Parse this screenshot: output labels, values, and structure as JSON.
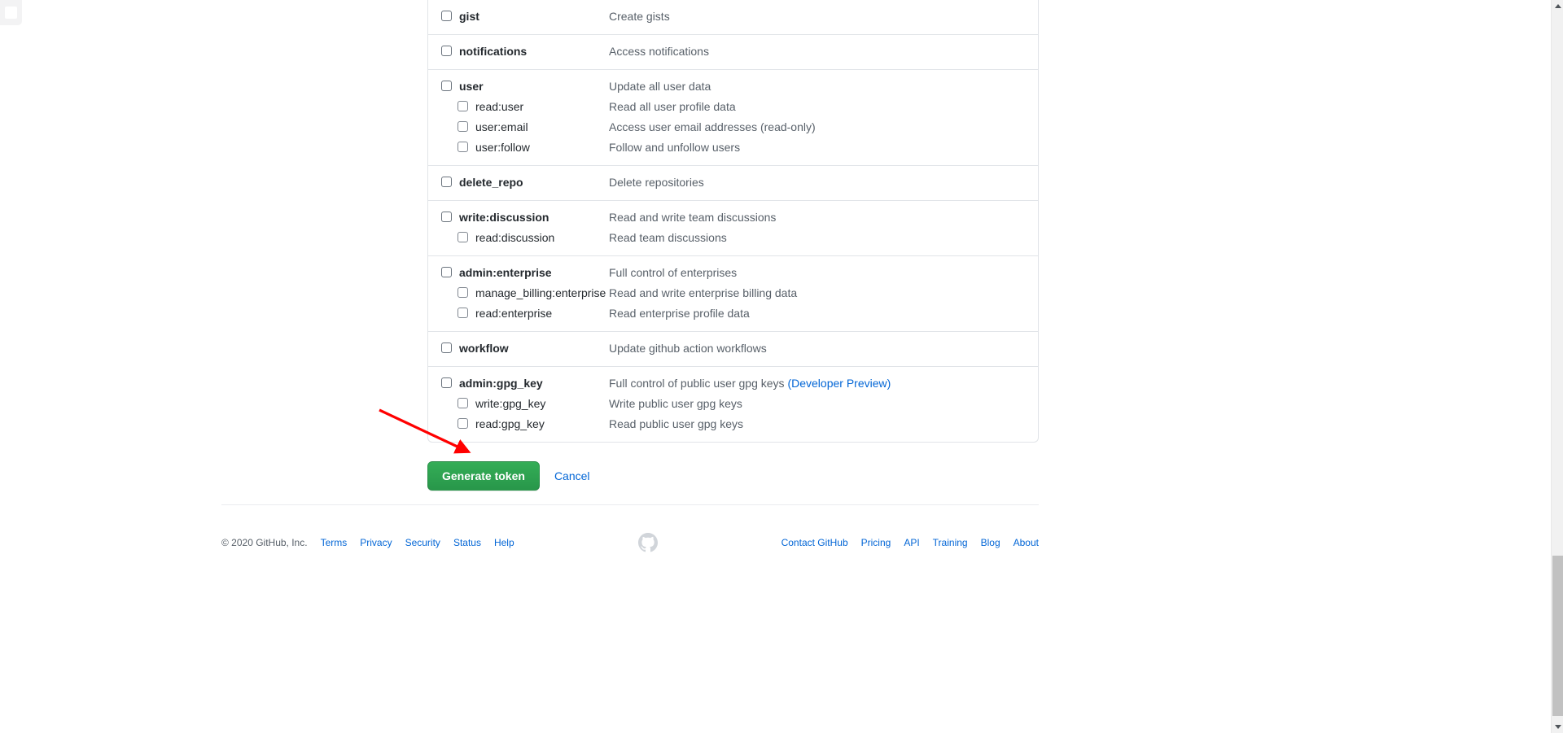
{
  "colors": {
    "primary_button": "#2ea44f",
    "link": "#0366d6",
    "text": "#24292e",
    "muted_text": "#586069",
    "border": "#e1e4e8",
    "annotation_arrow": "#ff0000"
  },
  "scopes": {
    "groups": [
      {
        "rows": [
          {
            "name": "gist",
            "description": "Create gists",
            "level": "parent",
            "checked": false
          }
        ]
      },
      {
        "rows": [
          {
            "name": "notifications",
            "description": "Access notifications",
            "level": "parent",
            "checked": false
          }
        ]
      },
      {
        "rows": [
          {
            "name": "user",
            "description": "Update all user data",
            "level": "parent",
            "checked": false
          },
          {
            "name": "read:user",
            "description": "Read all user profile data",
            "level": "child",
            "checked": false
          },
          {
            "name": "user:email",
            "description": "Access user email addresses (read-only)",
            "level": "child",
            "checked": false
          },
          {
            "name": "user:follow",
            "description": "Follow and unfollow users",
            "level": "child",
            "checked": false
          }
        ]
      },
      {
        "rows": [
          {
            "name": "delete_repo",
            "description": "Delete repositories",
            "level": "parent",
            "checked": false
          }
        ]
      },
      {
        "rows": [
          {
            "name": "write:discussion",
            "description": "Read and write team discussions",
            "level": "parent",
            "checked": false
          },
          {
            "name": "read:discussion",
            "description": "Read team discussions",
            "level": "child",
            "checked": false
          }
        ]
      },
      {
        "rows": [
          {
            "name": "admin:enterprise",
            "description": "Full control of enterprises",
            "level": "parent",
            "checked": false
          },
          {
            "name": "manage_billing:enterprise",
            "description": "Read and write enterprise billing data",
            "level": "child",
            "checked": false
          },
          {
            "name": "read:enterprise",
            "description": "Read enterprise profile data",
            "level": "child",
            "checked": false
          }
        ]
      },
      {
        "rows": [
          {
            "name": "workflow",
            "description": "Update github action workflows",
            "level": "parent",
            "checked": false
          }
        ]
      },
      {
        "rows": [
          {
            "name": "admin:gpg_key",
            "description": "Full control of public user gpg keys ",
            "description_link": "(Developer Preview)",
            "level": "parent",
            "checked": false
          },
          {
            "name": "write:gpg_key",
            "description": "Write public user gpg keys",
            "level": "child",
            "checked": false
          },
          {
            "name": "read:gpg_key",
            "description": "Read public user gpg keys",
            "level": "child",
            "checked": false
          }
        ]
      }
    ]
  },
  "actions": {
    "submit_label": "Generate token",
    "cancel_label": "Cancel"
  },
  "footer": {
    "copyright": "© 2020 GitHub, Inc.",
    "left_links": [
      "Terms",
      "Privacy",
      "Security",
      "Status",
      "Help"
    ],
    "right_links": [
      "Contact GitHub",
      "Pricing",
      "API",
      "Training",
      "Blog",
      "About"
    ],
    "logo": "github-mark-icon"
  },
  "scrollbar": {
    "up_arrow": "scroll-up-icon",
    "down_arrow": "scroll-down-icon"
  }
}
